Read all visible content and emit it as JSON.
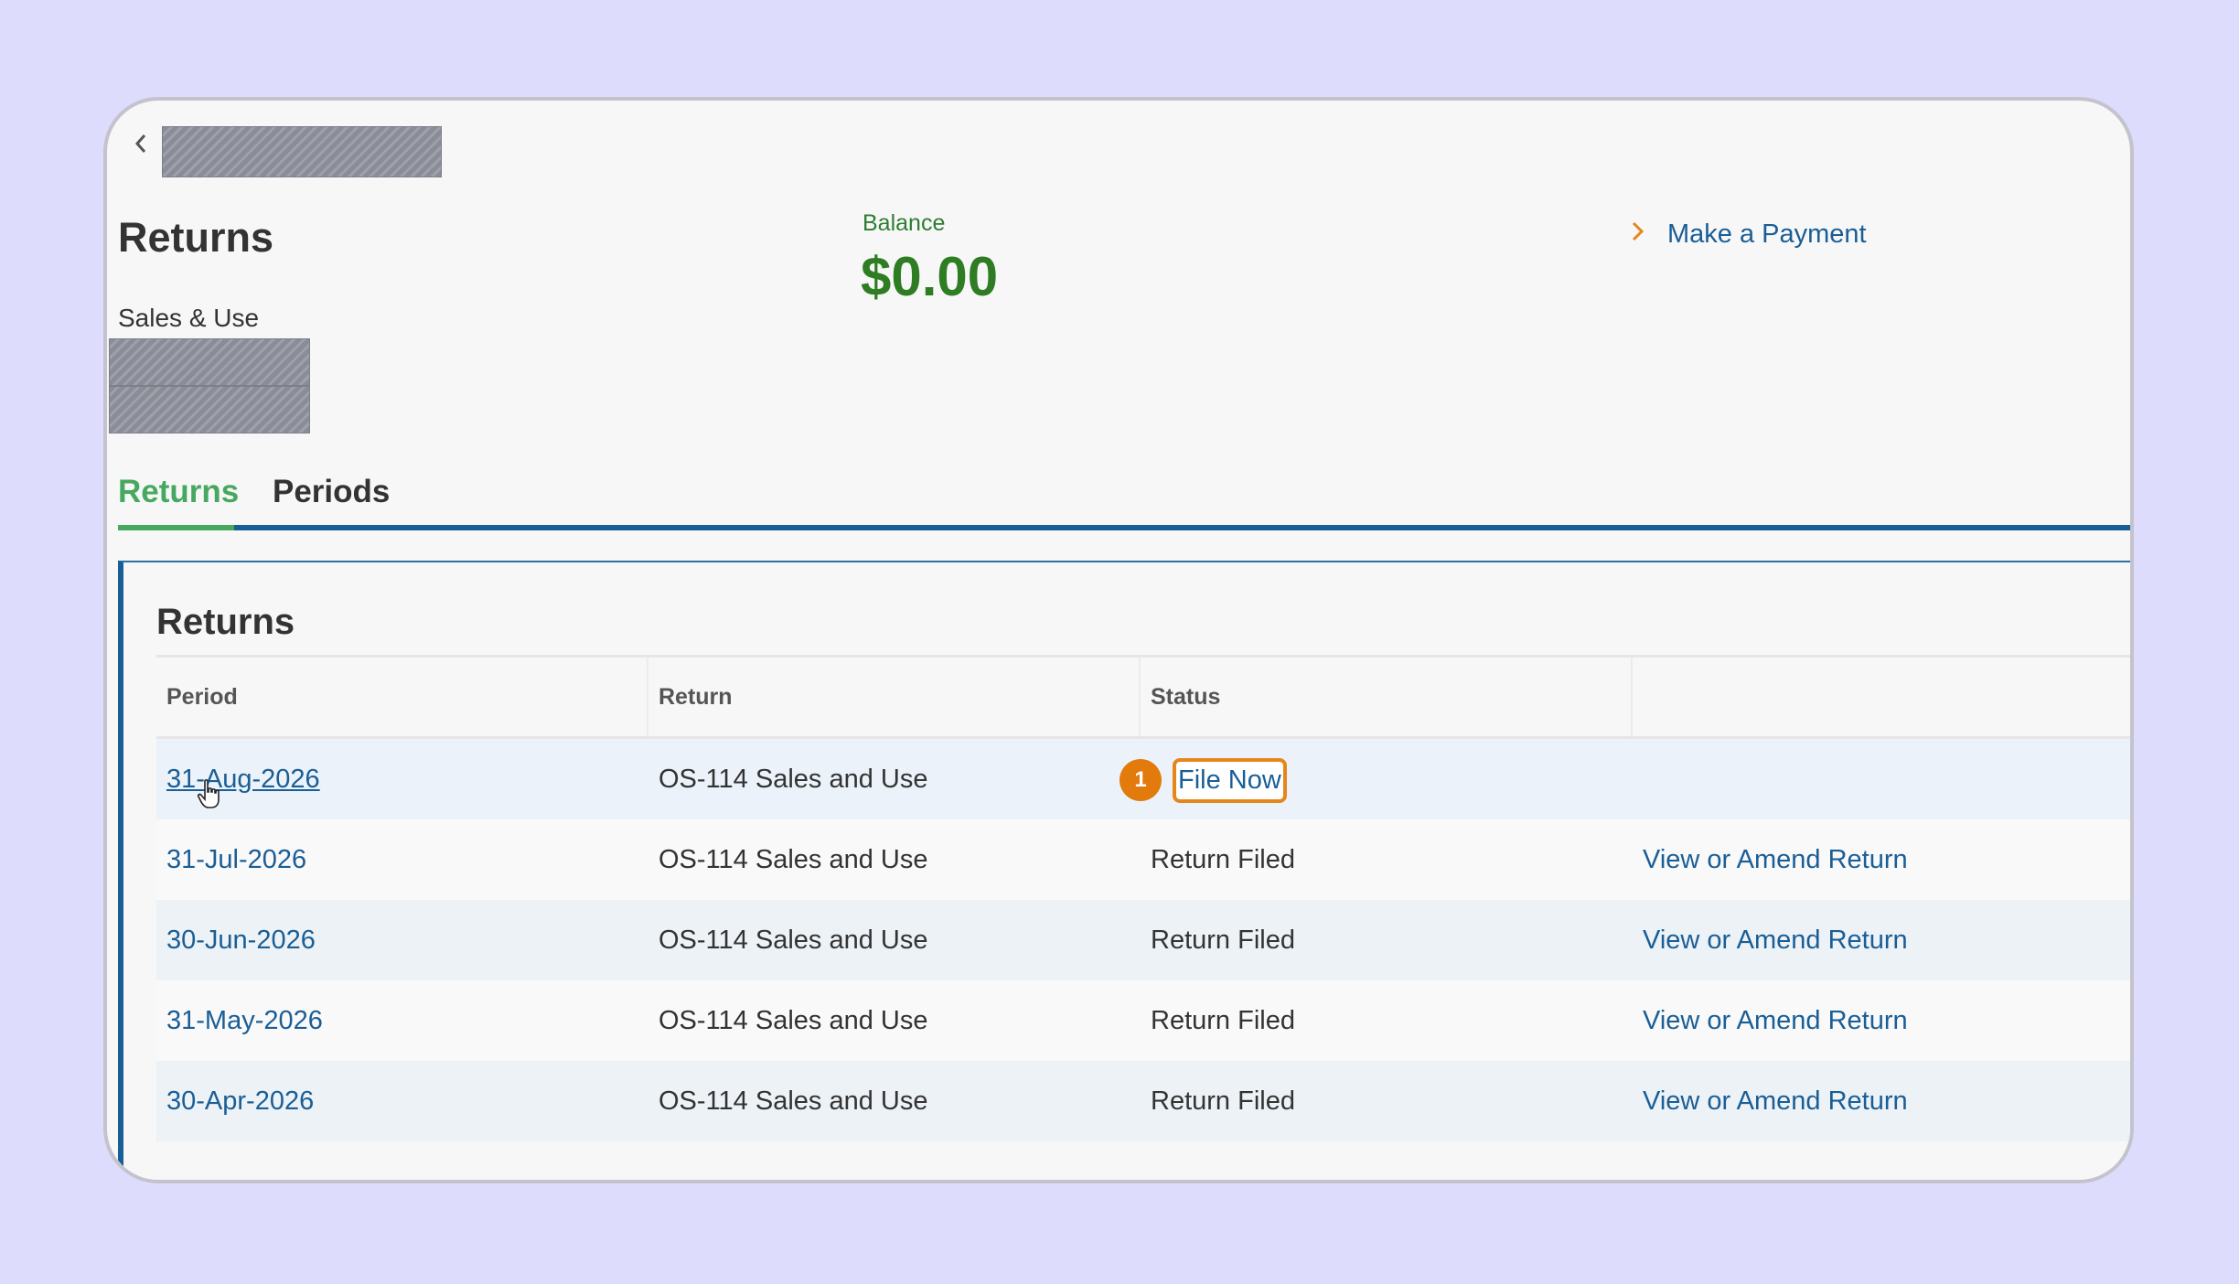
{
  "header": {
    "page_title": "Returns",
    "tax_type": "Sales & Use"
  },
  "balance": {
    "label": "Balance",
    "value": "$0.00"
  },
  "actions": {
    "make_payment": "Make a Payment"
  },
  "tabs": [
    {
      "label": "Returns",
      "active": true
    },
    {
      "label": "Periods",
      "active": false
    }
  ],
  "returns_panel": {
    "title": "Returns",
    "columns": [
      "Period",
      "Return",
      "Status",
      ""
    ],
    "rows": [
      {
        "period": "31-Aug-2026",
        "return": "OS-114 Sales and Use",
        "status": "",
        "action": "File Now"
      },
      {
        "period": "31-Jul-2026",
        "return": "OS-114 Sales and Use",
        "status": "Return Filed",
        "action": "View or Amend Return"
      },
      {
        "period": "30-Jun-2026",
        "return": "OS-114 Sales and Use",
        "status": "Return Filed",
        "action": "View or Amend Return"
      },
      {
        "period": "31-May-2026",
        "return": "OS-114 Sales and Use",
        "status": "Return Filed",
        "action": "View or Amend Return"
      },
      {
        "period": "30-Apr-2026",
        "return": "OS-114 Sales and Use",
        "status": "Return Filed",
        "action": "View or Amend Return"
      }
    ]
  },
  "step_badge": "1",
  "colors": {
    "accent_green": "#46a95f",
    "link_blue": "#1a5e96",
    "balance_green": "#2e7d22",
    "highlight_orange": "#e6861a"
  }
}
